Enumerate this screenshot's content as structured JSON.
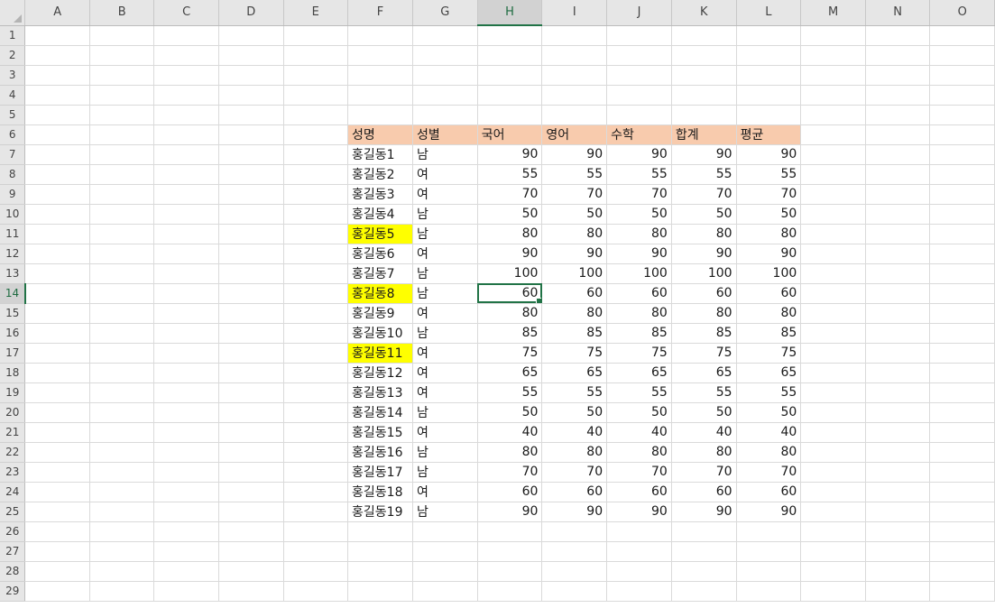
{
  "columns": [
    "A",
    "B",
    "C",
    "D",
    "E",
    "F",
    "G",
    "H",
    "I",
    "J",
    "K",
    "L",
    "M",
    "N",
    "O"
  ],
  "active_cell": "H14",
  "header": {
    "name": "성명",
    "gender": "성별",
    "korean": "국어",
    "english": "영어",
    "math": "수학",
    "total": "합계",
    "average": "평균"
  },
  "rows": [
    {
      "row": 7,
      "name": "홍길동1",
      "gender": "남",
      "korean": "90",
      "english": "90",
      "math": "90",
      "total": "90",
      "average": "90",
      "highlight": false
    },
    {
      "row": 8,
      "name": "홍길동2",
      "gender": "여",
      "korean": "55",
      "english": "55",
      "math": "55",
      "total": "55",
      "average": "55",
      "highlight": false
    },
    {
      "row": 9,
      "name": "홍길동3",
      "gender": "여",
      "korean": "70",
      "english": "70",
      "math": "70",
      "total": "70",
      "average": "70",
      "highlight": false
    },
    {
      "row": 10,
      "name": "홍길동4",
      "gender": "남",
      "korean": "50",
      "english": "50",
      "math": "50",
      "total": "50",
      "average": "50",
      "highlight": false
    },
    {
      "row": 11,
      "name": "홍길동5",
      "gender": "남",
      "korean": "80",
      "english": "80",
      "math": "80",
      "total": "80",
      "average": "80",
      "highlight": true
    },
    {
      "row": 12,
      "name": "홍길동6",
      "gender": "여",
      "korean": "90",
      "english": "90",
      "math": "90",
      "total": "90",
      "average": "90",
      "highlight": false
    },
    {
      "row": 13,
      "name": "홍길동7",
      "gender": "남",
      "korean": "100",
      "english": "100",
      "math": "100",
      "total": "100",
      "average": "100",
      "highlight": false
    },
    {
      "row": 14,
      "name": "홍길동8",
      "gender": "남",
      "korean": "60",
      "english": "60",
      "math": "60",
      "total": "60",
      "average": "60",
      "highlight": true
    },
    {
      "row": 15,
      "name": "홍길동9",
      "gender": "여",
      "korean": "80",
      "english": "80",
      "math": "80",
      "total": "80",
      "average": "80",
      "highlight": false
    },
    {
      "row": 16,
      "name": "홍길동10",
      "gender": "남",
      "korean": "85",
      "english": "85",
      "math": "85",
      "total": "85",
      "average": "85",
      "highlight": false
    },
    {
      "row": 17,
      "name": "홍길동11",
      "gender": "여",
      "korean": "75",
      "english": "75",
      "math": "75",
      "total": "75",
      "average": "75",
      "highlight": true
    },
    {
      "row": 18,
      "name": "홍길동12",
      "gender": "여",
      "korean": "65",
      "english": "65",
      "math": "65",
      "total": "65",
      "average": "65",
      "highlight": false
    },
    {
      "row": 19,
      "name": "홍길동13",
      "gender": "여",
      "korean": "55",
      "english": "55",
      "math": "55",
      "total": "55",
      "average": "55",
      "highlight": false
    },
    {
      "row": 20,
      "name": "홍길동14",
      "gender": "남",
      "korean": "50",
      "english": "50",
      "math": "50",
      "total": "50",
      "average": "50",
      "highlight": false
    },
    {
      "row": 21,
      "name": "홍길동15",
      "gender": "여",
      "korean": "40",
      "english": "40",
      "math": "40",
      "total": "40",
      "average": "40",
      "highlight": false
    },
    {
      "row": 22,
      "name": "홍길동16",
      "gender": "남",
      "korean": "80",
      "english": "80",
      "math": "80",
      "total": "80",
      "average": "80",
      "highlight": false
    },
    {
      "row": 23,
      "name": "홍길동17",
      "gender": "남",
      "korean": "70",
      "english": "70",
      "math": "70",
      "total": "70",
      "average": "70",
      "highlight": false
    },
    {
      "row": 24,
      "name": "홍길동18",
      "gender": "여",
      "korean": "60",
      "english": "60",
      "math": "60",
      "total": "60",
      "average": "60",
      "highlight": false
    },
    {
      "row": 25,
      "name": "홍길동19",
      "gender": "남",
      "korean": "90",
      "english": "90",
      "math": "90",
      "total": "90",
      "average": "90",
      "highlight": false
    }
  ],
  "colors": {
    "header_fill": "#f8cbad",
    "highlight_fill": "#ffff00",
    "selection": "#217346"
  }
}
